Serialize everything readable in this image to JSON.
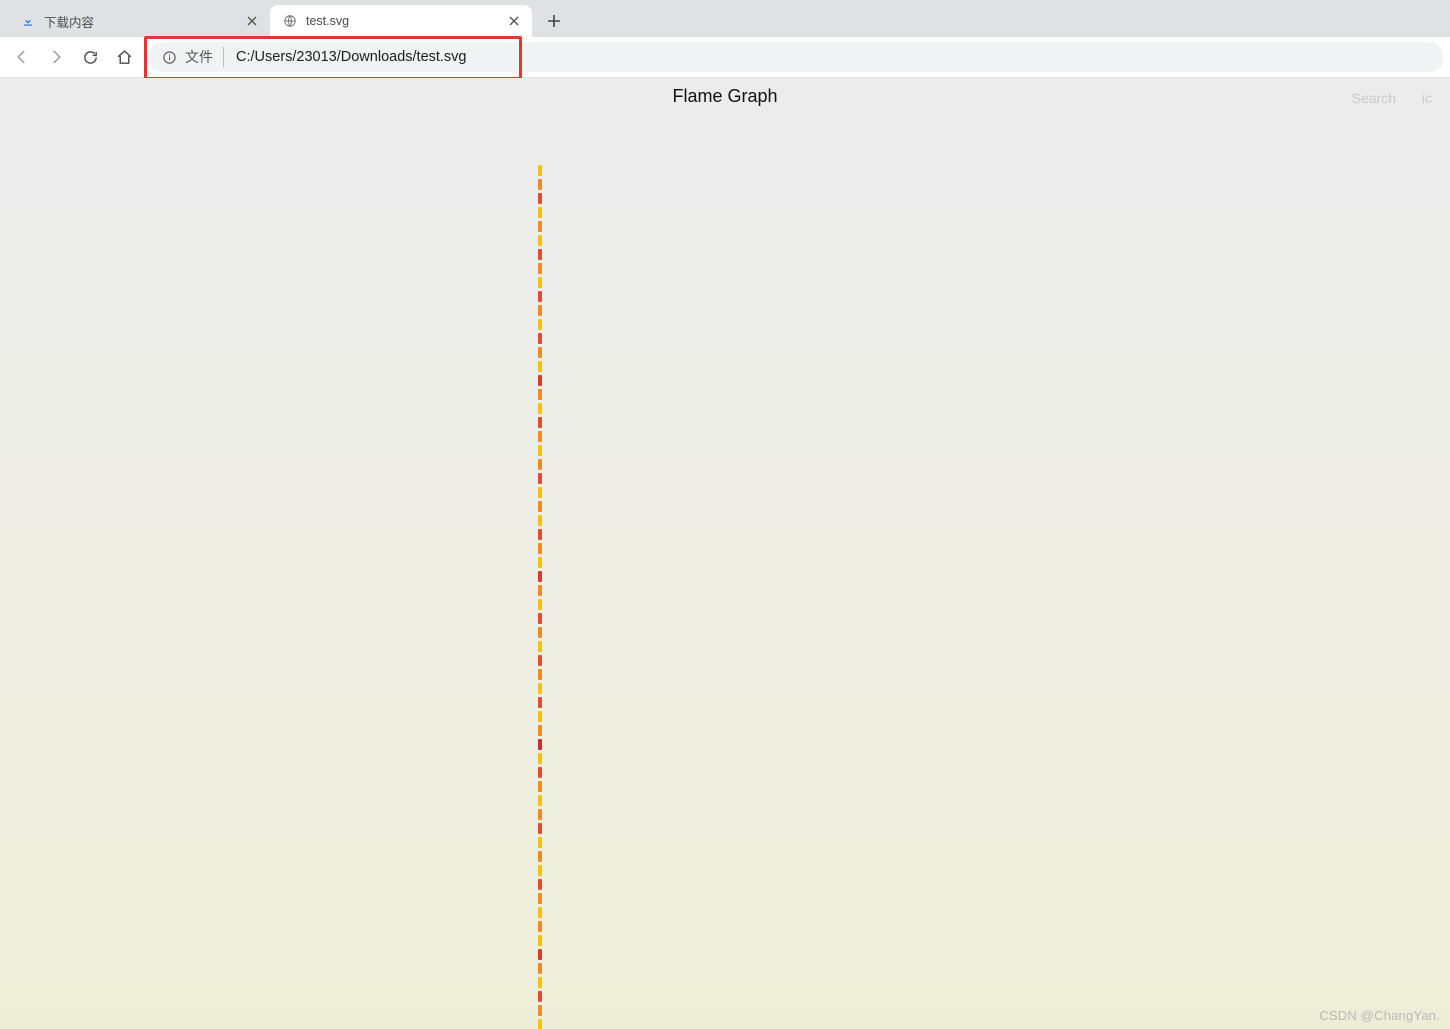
{
  "chrome": {
    "tabs": [
      {
        "title": "下载内容",
        "active": false,
        "icon": "download-icon"
      },
      {
        "title": "test.svg",
        "active": true,
        "icon": "globe-icon"
      }
    ],
    "new_tab_tooltip": "+",
    "nav": {
      "back_enabled": false,
      "forward_enabled": false,
      "reload_enabled": true,
      "home_enabled": true
    },
    "address": {
      "scheme_label": "文件",
      "url": "C:/Users/23013/Downloads/test.svg"
    }
  },
  "page": {
    "title": "Flame Graph",
    "search_label": "Search",
    "ic_label": "ic",
    "flame_colors": [
      "#f4c20d",
      "#f08a24",
      "#e74a33",
      "#f4c20d",
      "#f08a24",
      "#d83a2b",
      "#f4c20d",
      "#f08a24",
      "#f4c20d",
      "#f08a24",
      "#e74a33",
      "#f4c20d",
      "#f08a24",
      "#f4c20d",
      "#e74a33",
      "#f08a24",
      "#f4c20d",
      "#f08a24",
      "#e74a33",
      "#f4c20d",
      "#c9302c",
      "#f08a24",
      "#f4c20d",
      "#e74a33",
      "#f4c20d",
      "#f08a24",
      "#e74a33",
      "#f4c20d",
      "#f08a24",
      "#e74a33",
      "#f4c20d",
      "#f08a24",
      "#d83a2b",
      "#f4c20d",
      "#f08a24",
      "#e74a33",
      "#f4c20d",
      "#f08a24",
      "#f4c20d",
      "#e74a33",
      "#f08a24",
      "#f4c20d",
      "#f08a24",
      "#e74a33",
      "#f4c20d",
      "#f08a24",
      "#d83a2b",
      "#f4c20d",
      "#f08a24",
      "#e74a33",
      "#f4c20d",
      "#f08a24",
      "#e74a33",
      "#f4c20d",
      "#f08a24",
      "#e74a33",
      "#f4c20d",
      "#f08a24",
      "#f4c20d",
      "#e74a33",
      "#f08a24",
      "#f4c20d"
    ]
  },
  "watermark": "CSDN @ChangYan."
}
